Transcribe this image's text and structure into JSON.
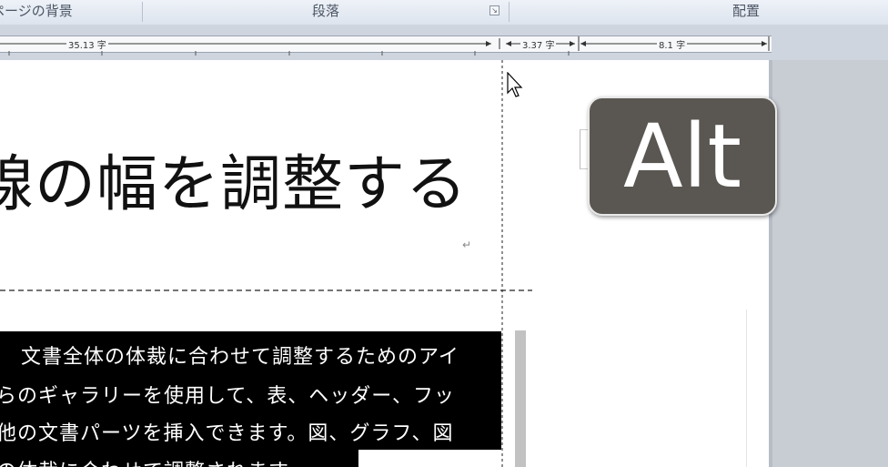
{
  "ribbon": {
    "groups": [
      "ページの背景",
      "段落",
      "配置"
    ]
  },
  "ruler": {
    "left_width": "35.13 字",
    "gap_width": "3.37 字",
    "right_width": "8.1 字"
  },
  "document": {
    "heading": "線の幅を調整する",
    "paragraph_lines": [
      "　文書全体の体裁に合わせて調整するためのアイ",
      "らのギャラリーを使用して、表、ヘッダー、フッ",
      "他の文書パーツを挿入できます。図、グラフ、図",
      "の体裁に合わせて調整されます"
    ],
    "paragraph_mark": "↵"
  },
  "overlay": {
    "key_label": "Alt"
  },
  "colors": {
    "badge": "#5a5752",
    "ribbon": "#dde4ee",
    "selection": "#000000"
  },
  "icons": {
    "launcher": "dialog-launcher-icon",
    "cursor": "arrow-cursor-icon"
  }
}
